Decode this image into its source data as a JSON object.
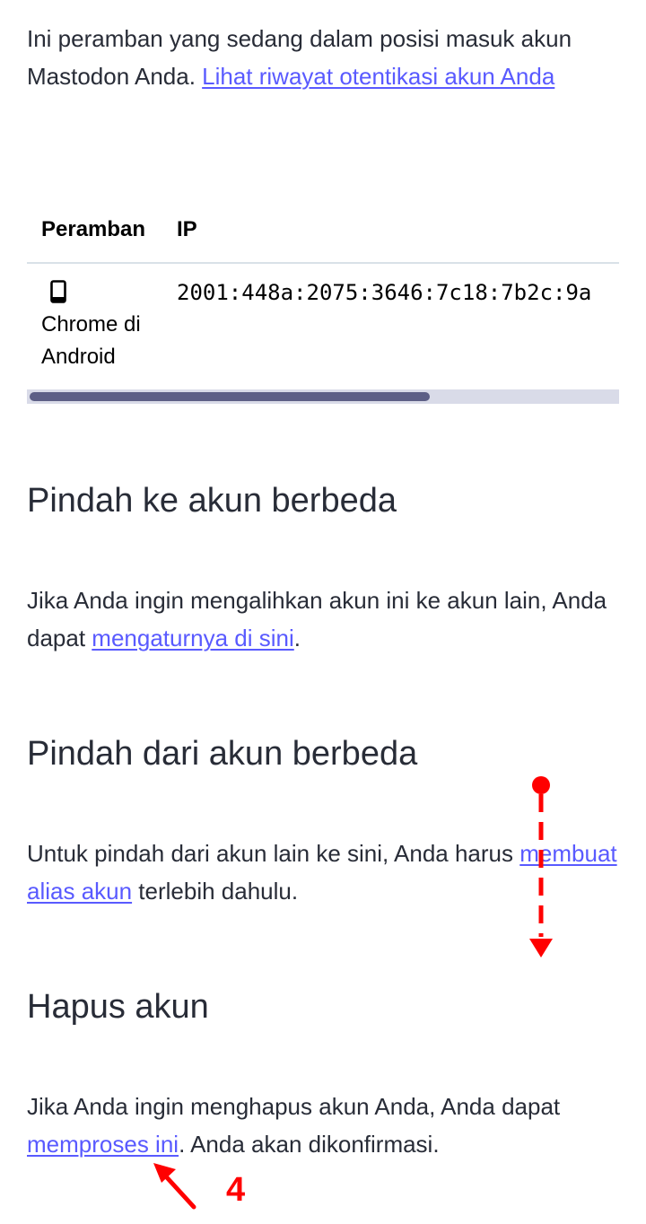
{
  "intro": {
    "text": "Ini peramban yang sedang dalam posisi masuk akun Mastodon Anda. ",
    "link": "Lihat riwayat otentikasi akun Anda"
  },
  "sessions_table": {
    "columns": [
      "Peramban",
      "IP"
    ],
    "rows": [
      {
        "device_icon": "mobile-phone-icon",
        "browser": "Chrome di Android",
        "ip": "2001:448a:2075:3646:7c18:7b2c:9a"
      }
    ]
  },
  "move_to": {
    "title": "Pindah ke akun berbeda",
    "text_before": "Jika Anda ingin mengalihkan akun ini ke akun lain, Anda dapat ",
    "link": "mengaturnya di sini",
    "text_after": "."
  },
  "move_from": {
    "title": "Pindah dari akun berbeda",
    "text_before": "Untuk pindah dari akun lain ke sini, Anda harus ",
    "link": "membuat alias akun",
    "text_after": " terlebih dahulu."
  },
  "delete": {
    "title": "Hapus akun",
    "text_before": "Jika Anda ingin menghapus akun Anda, Anda dapat ",
    "link": "memproses ini",
    "text_after": ". Anda akan dikonfirmasi."
  },
  "annotations": {
    "scroll_hint_icon": "dashed-down-arrow-icon",
    "pointer_icon": "red-arrow-icon",
    "step_number": "4",
    "color": "#ff0000"
  },
  "colors": {
    "text": "#282c37",
    "link": "#595aff",
    "scrollbar_thumb": "#5d5f86",
    "scrollbar_track": "#d9dbe8"
  }
}
